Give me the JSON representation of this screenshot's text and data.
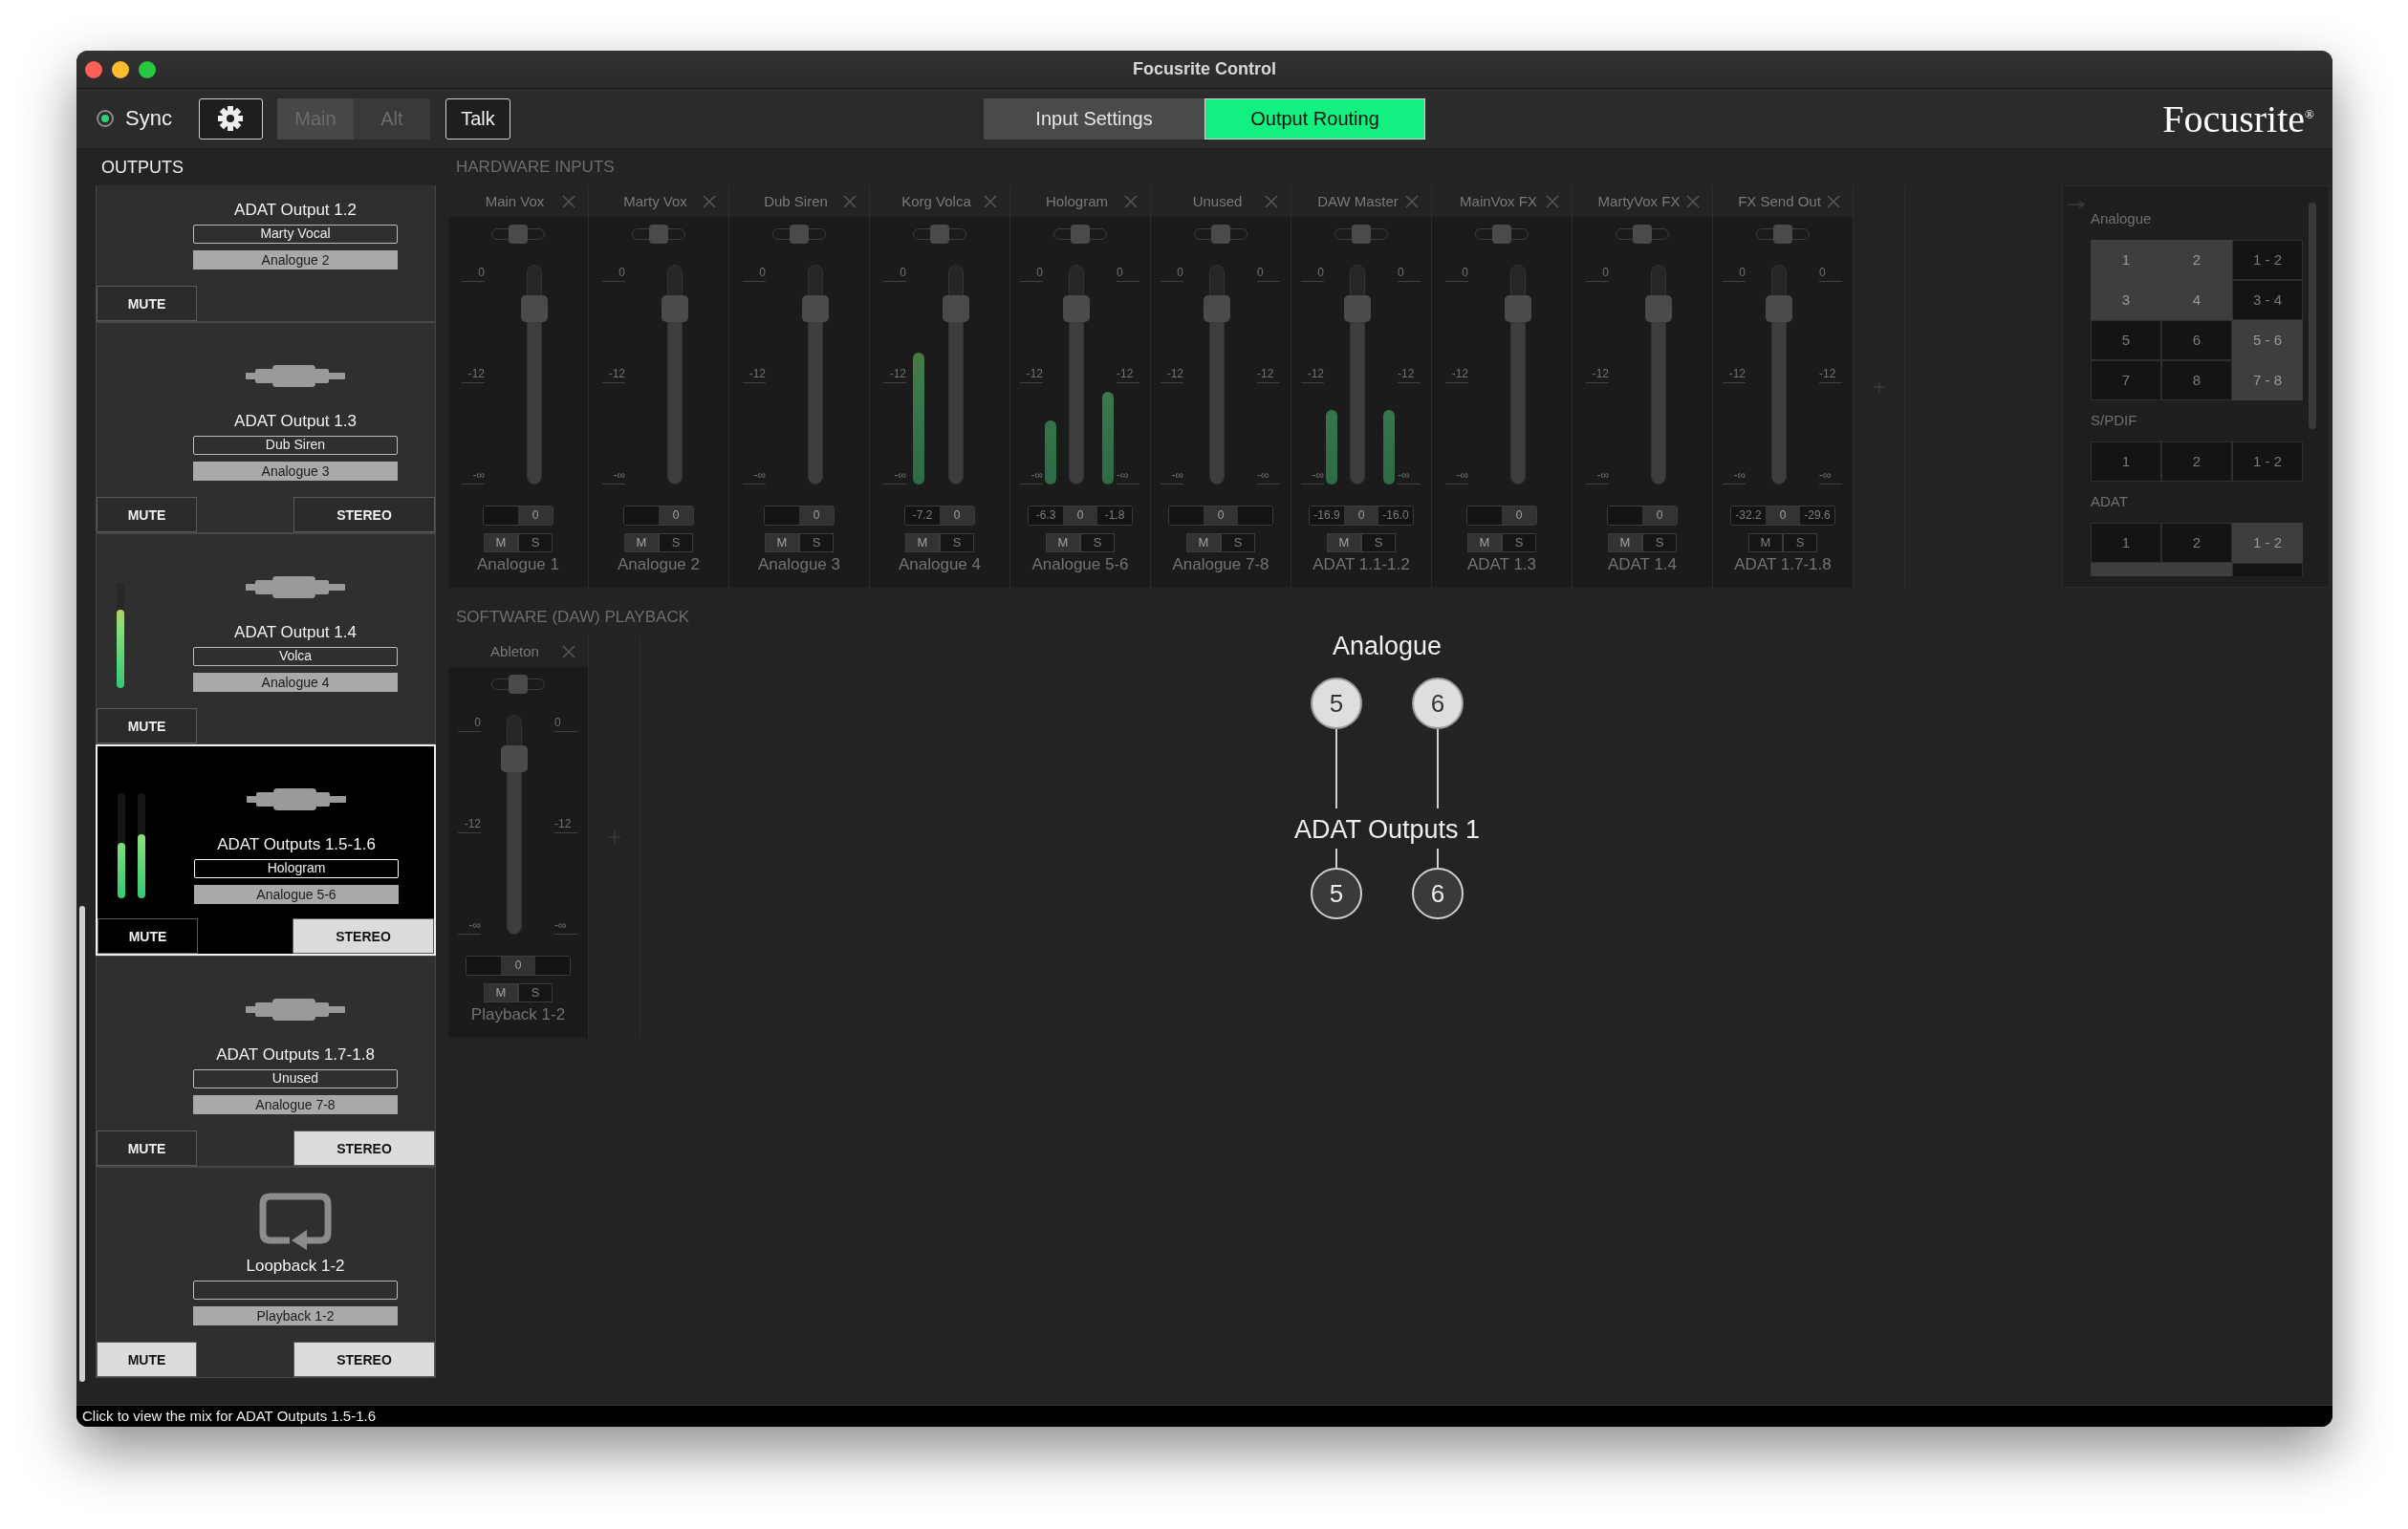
{
  "window": {
    "title": "Focusrite Control"
  },
  "toolbar": {
    "sync": {
      "label": "Sync",
      "on": true
    },
    "mix_buttons": [
      {
        "label": "Main",
        "selected": true,
        "disabled": true
      },
      {
        "label": "Alt",
        "selected": false,
        "disabled": true
      }
    ],
    "talk_button": {
      "label": "Talk"
    },
    "view_tabs": [
      {
        "label": "Input Settings",
        "selected": false
      },
      {
        "label": "Output Routing",
        "selected": true
      }
    ],
    "logo": "Focusrite$^{®}$"
  },
  "outputs": {
    "heading": "OUTPUTS",
    "items": [
      {
        "title": "ADAT Output 1.2",
        "name": "Marty Vocal",
        "source": "Analogue 2",
        "selected": false,
        "mute": {
          "label": "MUTE",
          "on": false
        }
      },
      {
        "title": "ADAT Output 1.3",
        "kind": "connector",
        "name": "Dub Siren",
        "source": "Analogue 3",
        "selected": false,
        "mute": {
          "label": "MUTE",
          "on": false
        },
        "stereo": {
          "label": "STEREO",
          "on": false
        }
      },
      {
        "title": "ADAT Output 1.4",
        "kind": "connector",
        "name": "Volca",
        "source": "Analogue 4",
        "selected": false,
        "meters": [
          {
            "level": 0.75
          }
        ],
        "mute": {
          "label": "MUTE",
          "on": false
        }
      },
      {
        "title": "ADAT Outputs 1.5-1.6",
        "kind": "connector",
        "name": "Hologram",
        "source": "Analogue 5-6",
        "selected": true,
        "meters": [
          {
            "level": 0.53
          },
          {
            "level": 0.61
          }
        ],
        "mute": {
          "label": "MUTE",
          "on": false
        },
        "stereo": {
          "label": "STEREO",
          "on": true
        }
      },
      {
        "title": "ADAT Outputs 1.7-1.8",
        "kind": "connector",
        "name": "Unused",
        "source": "Analogue 7-8",
        "selected": false,
        "mute": {
          "label": "MUTE",
          "on": false
        },
        "stereo": {
          "label": "STEREO",
          "on": true
        }
      },
      {
        "title": "Loopback 1-2",
        "kind": "loopback",
        "source": "Playback 1-2",
        "selected": false,
        "mute": {
          "label": "MUTE",
          "on": true
        },
        "stereo": {
          "label": "STEREO",
          "on": true
        }
      }
    ]
  },
  "hardware_inputs": {
    "heading": "HARDWARE INPUTS",
    "strips": [
      {
        "name": "Main Vox",
        "kind": "mono",
        "pan": {
          "level": 0.5
        },
        "level": 0.84,
        "scales": [
          [
            "0",
            "-12",
            "-∞"
          ]
        ],
        "gain": "0",
        "mute": {
          "label": "M",
          "on": true
        },
        "solo": {
          "label": "S",
          "on": false
        },
        "source": "Analogue 1"
      },
      {
        "name": "Marty Vox",
        "kind": "mono",
        "pan": {
          "level": 0.5
        },
        "level": 0.84,
        "scales": [
          [
            "0",
            "-12",
            "-∞"
          ]
        ],
        "gain": "0",
        "mute": {
          "label": "M",
          "on": true
        },
        "solo": {
          "label": "S",
          "on": false
        },
        "source": "Analogue 2"
      },
      {
        "name": "Dub Siren",
        "kind": "mono",
        "pan": {
          "level": 0.5
        },
        "level": 0.84,
        "scales": [
          [
            "0",
            "-12",
            "-∞"
          ]
        ],
        "gain": "0",
        "mute": {
          "label": "M",
          "on": true
        },
        "solo": {
          "label": "S",
          "on": false
        },
        "source": "Analogue 3"
      },
      {
        "name": "Korg Volca",
        "kind": "mono",
        "pan": {
          "level": 0.5
        },
        "level": 0.84,
        "scales": [
          [
            "0",
            "-12",
            "-∞"
          ]
        ],
        "meters": [
          {
            "level": 0.6
          }
        ],
        "peaks": [
          "-7.2"
        ],
        "gain": "0",
        "mute": {
          "label": "M",
          "on": true
        },
        "solo": {
          "label": "S",
          "on": false
        },
        "source": "Analogue 4"
      },
      {
        "name": "Hologram",
        "kind": "stereo",
        "pan": {
          "level": 0.5
        },
        "level": 0.84,
        "scales": [
          [
            "0",
            "-12",
            "-∞"
          ],
          [
            "0",
            "-12",
            "-∞"
          ]
        ],
        "meters": [
          {
            "level": 0.29
          },
          {
            "level": 0.42
          }
        ],
        "peaks": [
          "-6.3",
          "-1.8"
        ],
        "gain": "0",
        "mute": {
          "label": "M",
          "on": true
        },
        "solo": {
          "label": "S",
          "on": false
        },
        "source": "Analogue 5-6"
      },
      {
        "name": "Unused",
        "kind": "stereo",
        "pan": {
          "level": 0.5
        },
        "level": 0.84,
        "scales": [
          [
            "0",
            "-12",
            "-∞"
          ],
          [
            "0",
            "-12",
            "-∞"
          ]
        ],
        "gain": "0",
        "mute": {
          "label": "M",
          "on": true
        },
        "solo": {
          "label": "S",
          "on": false
        },
        "source": "Analogue 7-8"
      },
      {
        "name": "DAW Master",
        "kind": "stereo",
        "pan": {
          "level": 0.5
        },
        "level": 0.84,
        "scales": [
          [
            "0",
            "-12",
            "-∞"
          ],
          [
            "0",
            "-12",
            "-∞"
          ]
        ],
        "meters": [
          {
            "level": 0.34
          },
          {
            "level": 0.34
          }
        ],
        "peaks": [
          "-16.9",
          "-16.0"
        ],
        "gain": "0",
        "mute": {
          "label": "M",
          "on": true
        },
        "solo": {
          "label": "S",
          "on": false
        },
        "source": "ADAT 1.1-1.2"
      },
      {
        "name": "MainVox FX",
        "kind": "mono",
        "pan": {
          "level": 0.5
        },
        "level": 0.84,
        "scales": [
          [
            "0",
            "-12",
            "-∞"
          ]
        ],
        "gain": "0",
        "mute": {
          "label": "M",
          "on": true
        },
        "solo": {
          "label": "S",
          "on": false
        },
        "source": "ADAT 1.3"
      },
      {
        "name": "MartyVox FX",
        "kind": "mono",
        "pan": {
          "level": 0.5
        },
        "level": 0.84,
        "scales": [
          [
            "0",
            "-12",
            "-∞"
          ]
        ],
        "gain": "0",
        "mute": {
          "label": "M",
          "on": true
        },
        "solo": {
          "label": "S",
          "on": false
        },
        "source": "ADAT 1.4"
      },
      {
        "name": "FX Send Out",
        "kind": "stereo",
        "pan": {
          "level": 0.5
        },
        "level": 0.84,
        "scales": [
          [
            "0",
            "-12",
            "-∞"
          ],
          [
            "0",
            "-12",
            "-∞"
          ]
        ],
        "peaks": [
          "-32.2",
          "-29.6"
        ],
        "gain": "0",
        "mute": {
          "label": "M",
          "on": false
        },
        "solo": {
          "label": "S",
          "on": false
        },
        "source": "ADAT 1.7-1.8"
      }
    ]
  },
  "daw_playback": {
    "heading": "SOFTWARE (DAW) PLAYBACK",
    "strips": [
      {
        "name": "Ableton",
        "kind": "stereo",
        "pan": {
          "level": 0.5
        },
        "level": 0.84,
        "scales": [
          [
            "0",
            "-12",
            "-∞"
          ],
          [
            "0",
            "-12",
            "-∞"
          ]
        ],
        "gain": "0",
        "mute": {
          "label": "M",
          "on": true
        },
        "solo": {
          "label": "S",
          "on": false
        },
        "source": "Playback 1-2"
      }
    ]
  },
  "routing_panel": {
    "sections": [
      {
        "label": "Analogue",
        "cells": [
          {
            "label": "1",
            "used": true
          },
          {
            "label": "2",
            "used": true
          },
          {
            "label": "1 - 2",
            "used": false
          },
          {
            "label": "3",
            "used": true
          },
          {
            "label": "4",
            "used": true
          },
          {
            "label": "3 - 4",
            "used": false
          },
          {
            "label": "5",
            "used": false
          },
          {
            "label": "6",
            "used": false
          },
          {
            "label": "5 - 6",
            "used": true
          },
          {
            "label": "7",
            "used": false
          },
          {
            "label": "8",
            "used": false
          },
          {
            "label": "7 - 8",
            "used": true
          }
        ]
      },
      {
        "label": "S/PDIF",
        "cells": [
          {
            "label": "1",
            "used": false
          },
          {
            "label": "2",
            "used": false
          },
          {
            "label": "1 - 2",
            "used": false
          }
        ]
      },
      {
        "label": "ADAT",
        "cells": [
          {
            "label": "1",
            "used": false
          },
          {
            "label": "2",
            "used": false
          },
          {
            "label": "1 - 2",
            "used": true
          },
          {
            "used": true
          },
          {
            "used": true
          },
          {
            "used": false
          }
        ]
      }
    ]
  },
  "routing_diagram": {
    "source": {
      "label": "Analogue",
      "channels": [
        "5",
        "6"
      ]
    },
    "destination": {
      "label": "ADAT Outputs 1",
      "channels": [
        "5",
        "6"
      ]
    }
  },
  "status_bar": {
    "text": "Click to view the mix for ADAT Outputs 1.5-1.6"
  }
}
